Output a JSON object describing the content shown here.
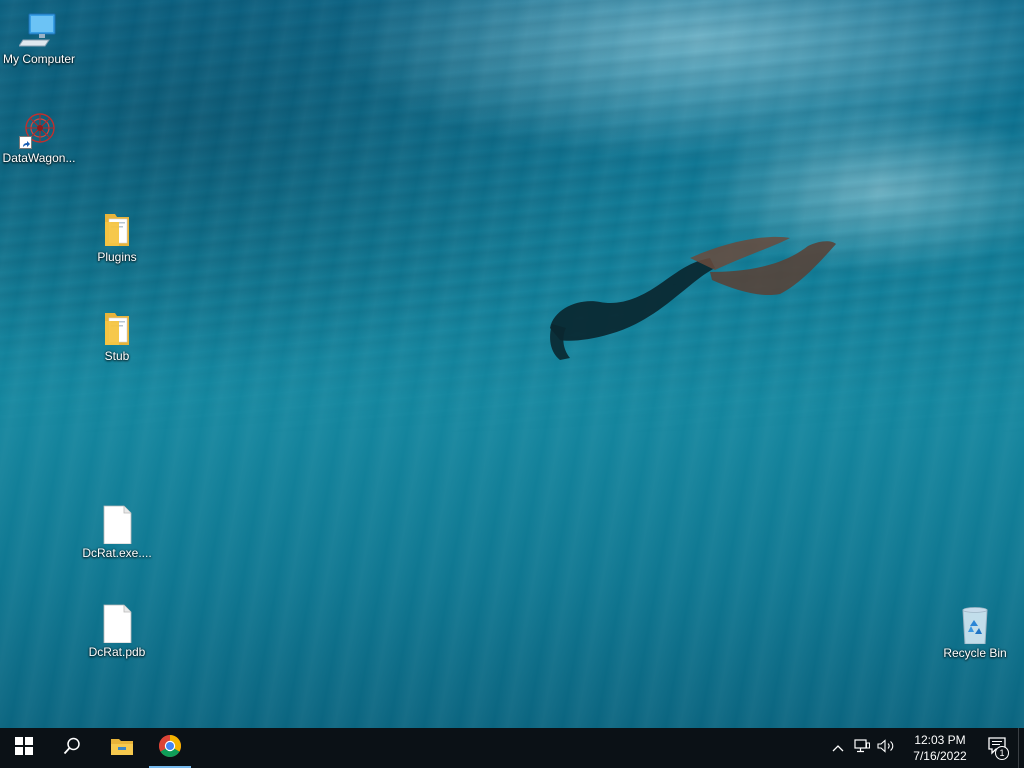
{
  "desktop": {
    "icons": [
      {
        "label": "My Computer",
        "icon": "computer-icon"
      },
      {
        "label": "DataWagon...",
        "icon": "datawagon-shortcut-icon"
      },
      {
        "label": "Plugins",
        "icon": "folder-icon"
      },
      {
        "label": "Stub",
        "icon": "folder-icon"
      },
      {
        "label": "DcRat.exe....",
        "icon": "file-icon"
      },
      {
        "label": "DcRat.pdb",
        "icon": "file-icon"
      },
      {
        "label": "Recycle Bin",
        "icon": "recycle-bin-icon"
      }
    ]
  },
  "taskbar": {
    "items": [
      {
        "icon": "windows-start-icon"
      },
      {
        "icon": "search-icon"
      },
      {
        "icon": "file-explorer-icon"
      },
      {
        "icon": "chrome-icon",
        "active": true
      }
    ],
    "tray": {
      "time": "12:03 PM",
      "date": "7/16/2022",
      "notification_count": "1",
      "icons": [
        "chevron-up-icon",
        "network-icon",
        "volume-icon",
        "notification-icon"
      ]
    }
  },
  "colors": {
    "taskbar_bg": "#0b1116",
    "active_indicator": "#76b9ed",
    "folder_yellow": "#f5c542"
  }
}
